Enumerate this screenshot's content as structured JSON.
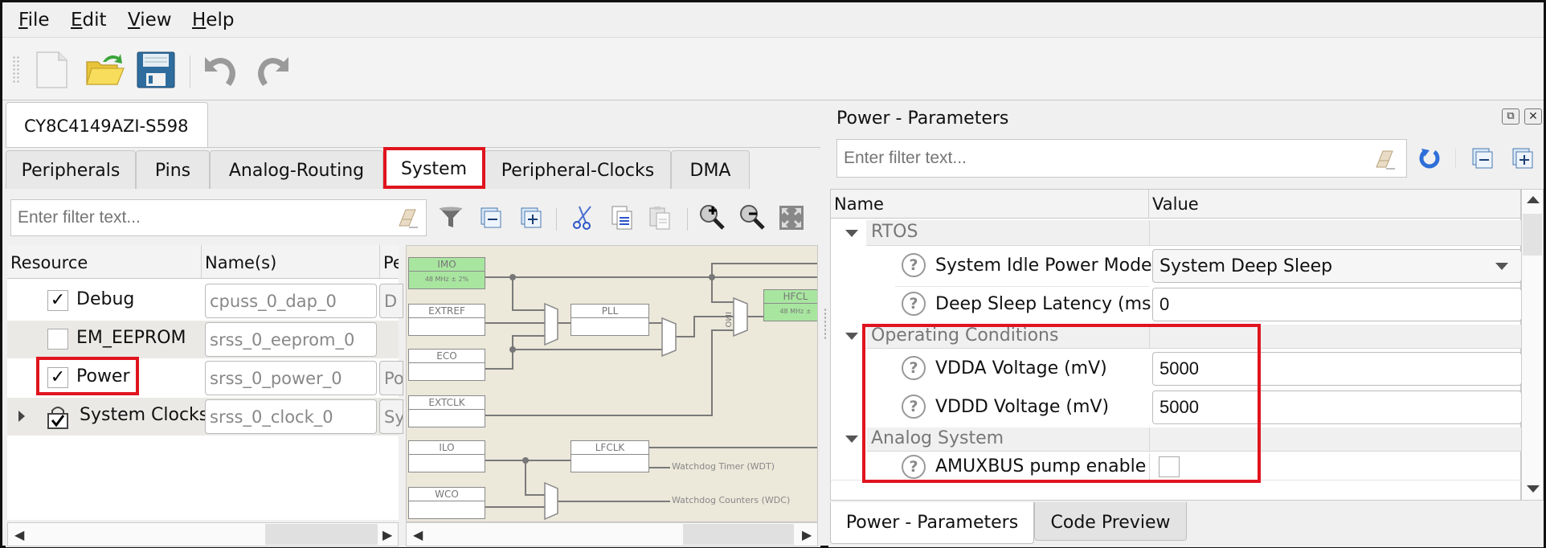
{
  "menu": {
    "items": [
      {
        "label": "File",
        "accel": "F",
        "rest": "ile"
      },
      {
        "label": "Edit",
        "accel": "E",
        "rest": "dit"
      },
      {
        "label": "View",
        "accel": "V",
        "rest": "iew"
      },
      {
        "label": "Help",
        "accel": "H",
        "rest": "elp"
      }
    ]
  },
  "toolbar": {
    "icons": [
      "new-file-icon",
      "open-folder-icon",
      "save-icon",
      "undo-icon",
      "redo-icon"
    ]
  },
  "document_tab": {
    "label": "CY8C4149AZI-S598"
  },
  "left": {
    "tabs": [
      {
        "label": "Peripherals"
      },
      {
        "label": "Pins"
      },
      {
        "label": "Analog-Routing"
      },
      {
        "label": "System",
        "active": true,
        "highlighted": true
      },
      {
        "label": "Peripheral-Clocks"
      },
      {
        "label": "DMA"
      }
    ],
    "filter": {
      "placeholder": "Enter filter text..."
    },
    "toolbar_icons": [
      "filter-funnel-icon",
      "collapse-all-icon",
      "expand-all-icon",
      "cut-icon",
      "copy-icon",
      "paste-icon",
      "zoom-in-icon",
      "zoom-out-icon",
      "zoom-fit-icon"
    ],
    "table": {
      "columns": [
        "Resource",
        "Name(s)",
        "Pe"
      ],
      "rows": [
        {
          "resource": "Debug",
          "checked": true,
          "name": "cpuss_0_dap_0",
          "pe": "D"
        },
        {
          "resource": "EM_EEPROM",
          "checked": false,
          "name": "srss_0_eeprom_0",
          "pe": ""
        },
        {
          "resource": "Power",
          "checked": true,
          "name": "srss_0_power_0",
          "pe": "Po",
          "highlighted": true
        },
        {
          "resource": "System Clocks",
          "checked": "locked",
          "name": "srss_0_clock_0",
          "pe": "Sy",
          "expandable": true
        }
      ]
    },
    "diagram": {
      "blocks": [
        {
          "label": "IMO",
          "sub": "48 MHz ± 2%",
          "enabled": true
        },
        {
          "label": "EXTREF",
          "sub": "",
          "enabled": false
        },
        {
          "label": "ECO",
          "sub": "",
          "enabled": false
        },
        {
          "label": "EXTCLK",
          "sub": "",
          "enabled": false
        },
        {
          "label": "ILO",
          "sub": "",
          "enabled": false
        },
        {
          "label": "WCO",
          "sub": "",
          "enabled": false
        },
        {
          "label": "PLL",
          "sub": "",
          "enabled": false
        },
        {
          "label": "LFCLK",
          "sub": "",
          "enabled": false
        },
        {
          "label": "HFCL",
          "sub": "48 MHz ±",
          "enabled": true
        }
      ],
      "mux_label": "IMO",
      "outputs": [
        "Watchdog Timer (WDT)",
        "Watchdog Counters (WDC)"
      ]
    }
  },
  "right": {
    "title": "Power - Parameters",
    "filter": {
      "placeholder": "Enter filter text..."
    },
    "columns": [
      "Name",
      "Value"
    ],
    "groups": [
      {
        "label": "RTOS",
        "params": [
          {
            "label": "System Idle Power Mode",
            "type": "dropdown",
            "value": "System Deep Sleep"
          },
          {
            "label": "Deep Sleep Latency (ms)",
            "type": "text",
            "value": "0"
          }
        ]
      },
      {
        "label": "Operating Conditions",
        "params": [
          {
            "label": "VDDA Voltage (mV)",
            "type": "text",
            "value": "5000"
          },
          {
            "label": "VDDD Voltage (mV)",
            "type": "text",
            "value": "5000"
          }
        ]
      },
      {
        "label": "Analog System",
        "params": [
          {
            "label": "AMUXBUS pump enable",
            "type": "checkbox",
            "value": false
          }
        ]
      }
    ],
    "bottom_tabs": [
      {
        "label": "Power - Parameters",
        "active": true
      },
      {
        "label": "Code Preview",
        "active": false
      }
    ]
  },
  "colors": {
    "highlight": "#e0141e",
    "enabled_block": "#a8e6a0",
    "diagram_bg": "#ece8da"
  }
}
